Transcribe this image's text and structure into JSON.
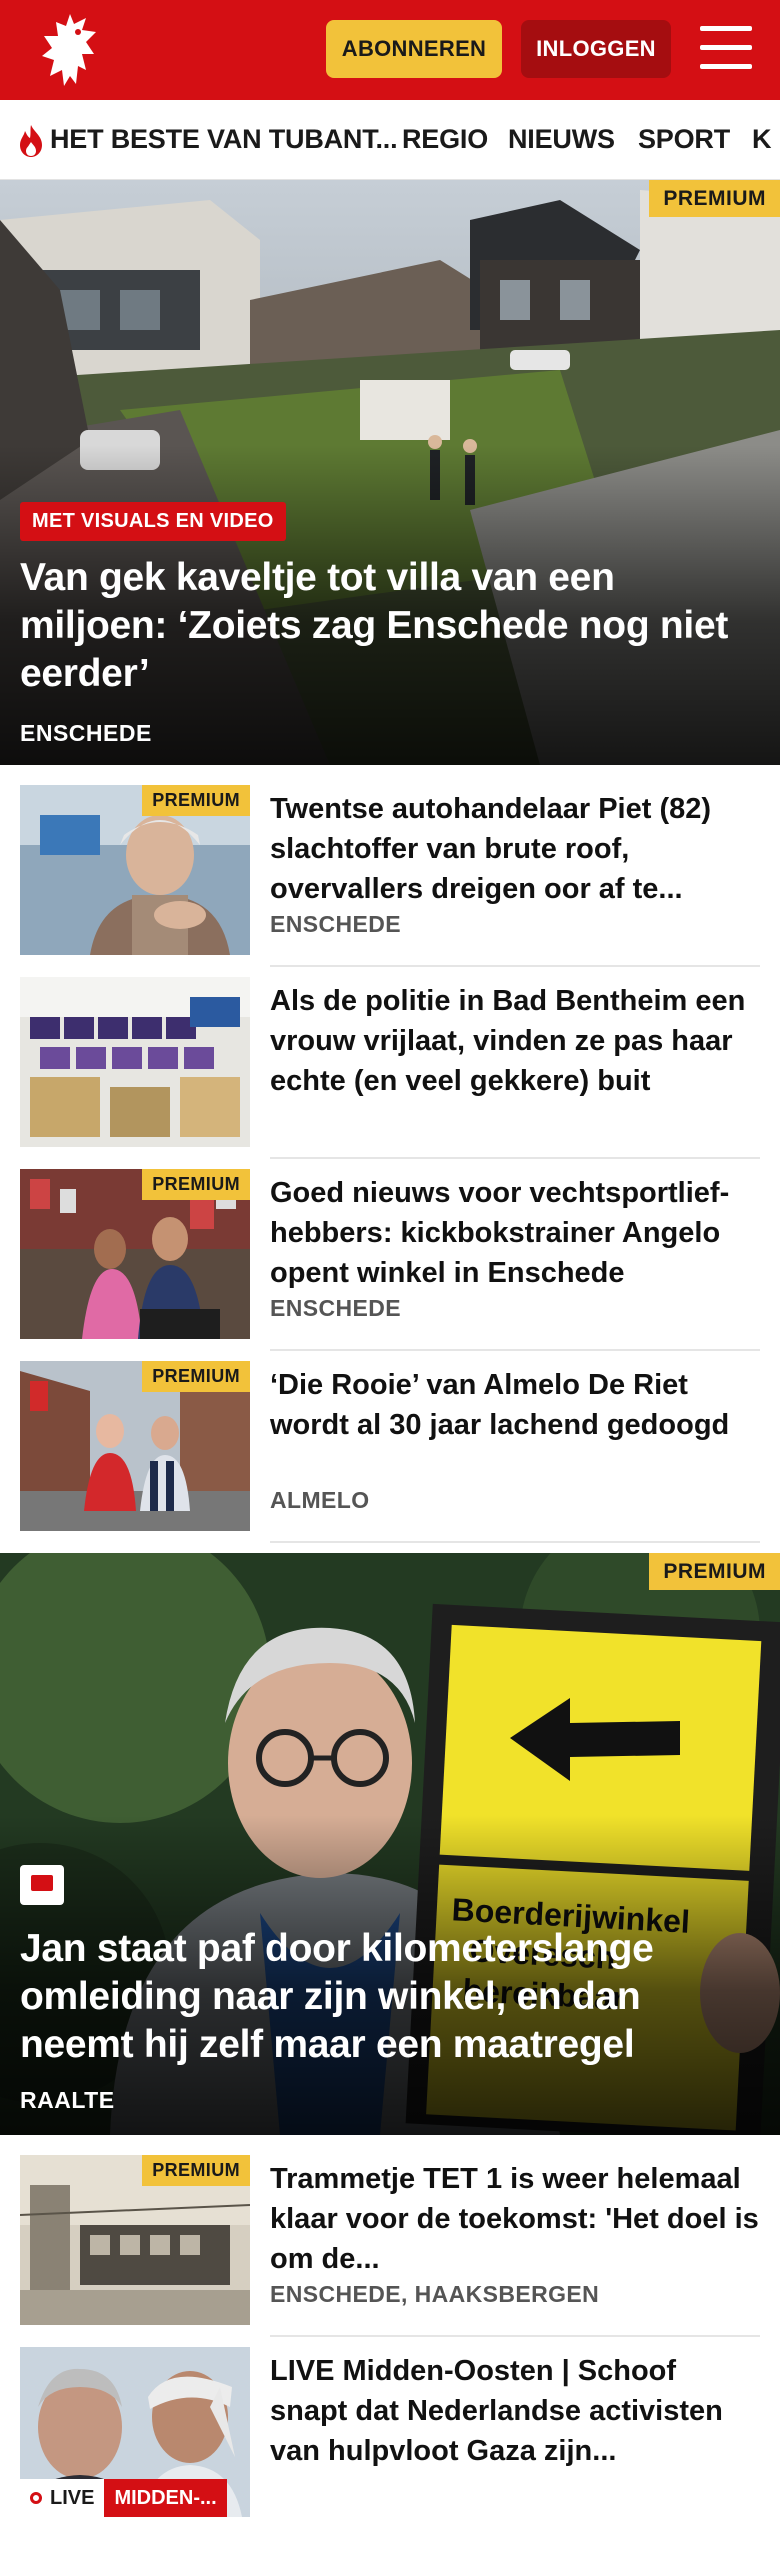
{
  "header": {
    "subscribe_label": "ABONNEREN",
    "login_label": "INLOGGEN",
    "brand_color": "#d40f14"
  },
  "nav": {
    "items": [
      {
        "label": "HET BESTE VAN TUBANT...",
        "icon": "flame-icon"
      },
      {
        "label": "REGIO"
      },
      {
        "label": "NIEUWS"
      },
      {
        "label": "SPORT"
      },
      {
        "label": "K"
      }
    ]
  },
  "hero1": {
    "premium": "PREMIUM",
    "label": "MET VISUALS EN VIDEO",
    "title": "Van gek kaveltje tot villa van een miljoen: ‘Zoiets zag Enschede nog niet eerder’",
    "location": "ENSCHEDE"
  },
  "articles": [
    {
      "premium": "PREMIUM",
      "title": "Twentse autohandelaar Piet (82) slachtoffer van brute roof, overvallers dreigen oor af te...",
      "location": "ENSCHEDE"
    },
    {
      "premium": "",
      "title": "Als de politie in Bad Bentheim een vrouw vrijlaat, vinden ze pas haar echte (en veel gekkere) buit",
      "location": ""
    },
    {
      "premium": "PREMIUM",
      "title": "Goed nieuws voor vechtsportlief­hebbers: kickbokstrainer Angelo opent winkel in Enschede",
      "location": "ENSCHEDE"
    },
    {
      "premium": "PREMIUM",
      "title": "‘Die Rooie’ van Almelo De Riet wordt al 30 jaar lachend gedoogd",
      "location": "ALMELO"
    }
  ],
  "hero2": {
    "premium": "PREMIUM",
    "comment_icon": "comment-icon",
    "title": "Jan staat paf door kilometerslange omleiding naar zijn winkel, en dan neemt hij zelf maar een maatregel",
    "location": "RAALTE",
    "sign_text": "Boerderijwinkel Overesch bereikbaar"
  },
  "articles2": [
    {
      "premium": "PREMIUM",
      "title": "Trammetje TET 1 is weer helemaal klaar voor de toekomst: 'Het doel is om de...",
      "location": "ENSCHEDE, HAAKSBERGEN"
    },
    {
      "live": "LIVE",
      "topic": "MIDDEN-...",
      "title": "LIVE Midden-Oosten | Schoof snapt dat Nederlandse activisten van hulpvloot Gaza zijn..."
    }
  ]
}
